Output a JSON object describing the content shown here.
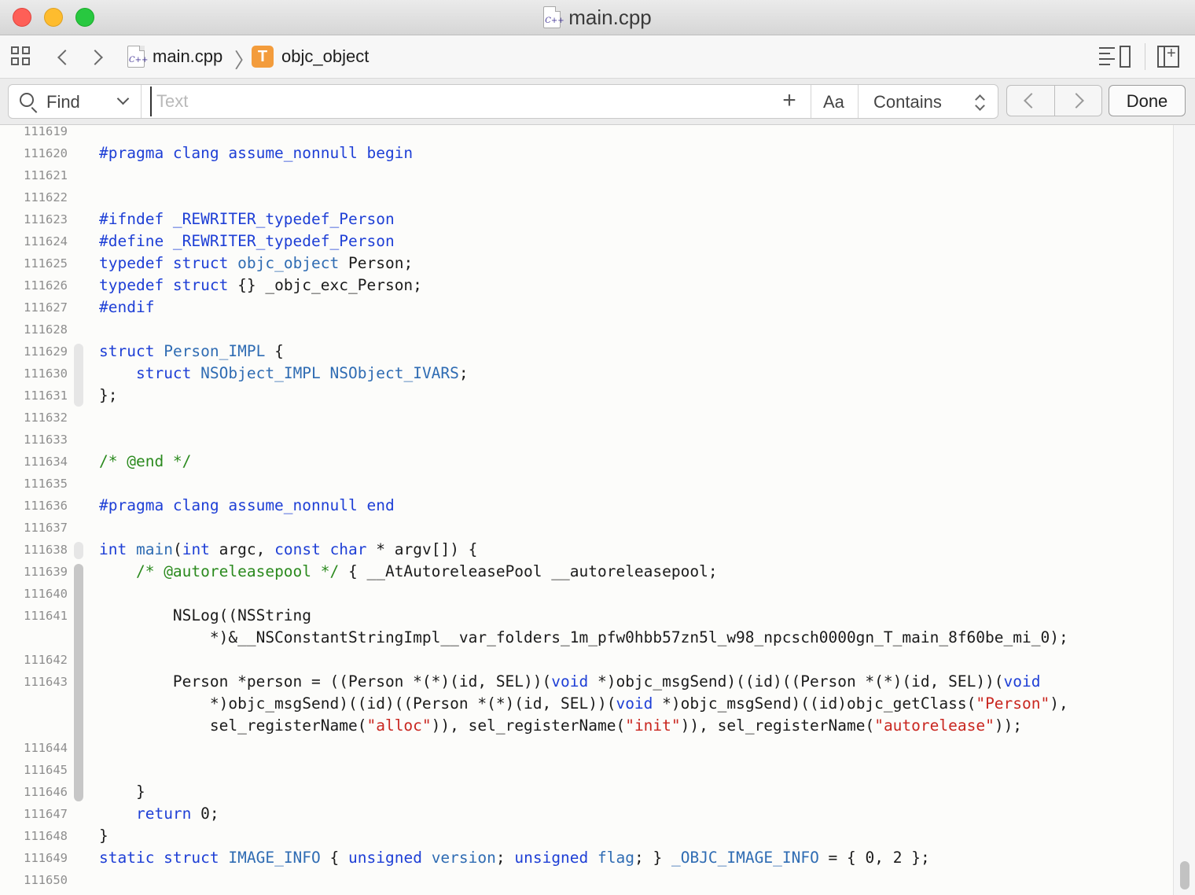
{
  "window": {
    "title": "main.cpp",
    "file_icon_label": "C++"
  },
  "nav": {
    "crumb_file": "main.cpp",
    "crumb_symbol_badge": "T",
    "crumb_symbol": "objc_object"
  },
  "find": {
    "mode": "Find",
    "placeholder": "Text",
    "value": "",
    "case_label": "Aa",
    "match_mode": "Contains",
    "done_label": "Done"
  },
  "editor": {
    "lines": [
      {
        "n": "111619",
        "code": ""
      },
      {
        "n": "111620",
        "code": "<span class=\"kw\">#pragma clang assume_nonnull begin</span>"
      },
      {
        "n": "111621",
        "code": ""
      },
      {
        "n": "111622",
        "code": ""
      },
      {
        "n": "111623",
        "code": "<span class=\"kw\">#ifndef _REWRITER_typedef_Person</span>"
      },
      {
        "n": "111624",
        "code": "<span class=\"kw\">#define _REWRITER_typedef_Person</span>"
      },
      {
        "n": "111625",
        "code": "<span class=\"kw\">typedef struct</span> <span class=\"ty\">objc_object</span> Person;"
      },
      {
        "n": "111626",
        "code": "<span class=\"kw\">typedef struct</span> {} _objc_exc_Person;"
      },
      {
        "n": "111627",
        "code": "<span class=\"kw\">#endif</span>"
      },
      {
        "n": "111628",
        "code": ""
      },
      {
        "n": "111629",
        "code": "<span class=\"kw\">struct</span> <span class=\"ty\">Person_IMPL</span> {"
      },
      {
        "n": "111630",
        "code": "    <span class=\"kw\">struct</span> <span class=\"ty\">NSObject_IMPL</span> <span class=\"ty\">NSObject_IVARS</span>;"
      },
      {
        "n": "111631",
        "code": "};"
      },
      {
        "n": "111632",
        "code": ""
      },
      {
        "n": "111633",
        "code": ""
      },
      {
        "n": "111634",
        "code": "<span class=\"cm\">/* @end */</span>"
      },
      {
        "n": "111635",
        "code": ""
      },
      {
        "n": "111636",
        "code": "<span class=\"kw\">#pragma clang assume_nonnull end</span>"
      },
      {
        "n": "111637",
        "code": ""
      },
      {
        "n": "111638",
        "code": "<span class=\"kw\">int</span> <span class=\"ty\">main</span>(<span class=\"kw\">int</span> argc, <span class=\"kw\">const char</span> * argv[]) {"
      },
      {
        "n": "111639",
        "code": "    <span class=\"cm\">/* @autoreleasepool */</span> { __AtAutoreleasePool __autoreleasepool;"
      },
      {
        "n": "111640",
        "code": ""
      },
      {
        "n": "111641",
        "code": "        NSLog((NSString"
      },
      {
        "n": "",
        "code": "            *)&amp;__NSConstantStringImpl__var_folders_1m_pfw0hbb57zn5l_w98_npcsch0000gn_T_main_8f60be_mi_0);"
      },
      {
        "n": "111642",
        "code": ""
      },
      {
        "n": "111643",
        "code": "        Person *person = ((Person *(*)(id, SEL))(<span class=\"kw\">void</span> *)objc_msgSend)((id)((Person *(*)(id, SEL))(<span class=\"kw\">void</span>"
      },
      {
        "n": "",
        "code": "            *)objc_msgSend)((id)((Person *(*)(id, SEL))(<span class=\"kw\">void</span> *)objc_msgSend)((id)objc_getClass(<span class=\"st\">\"Person\"</span>),"
      },
      {
        "n": "",
        "code": "            sel_registerName(<span class=\"st\">\"alloc\"</span>)), sel_registerName(<span class=\"st\">\"init\"</span>)), sel_registerName(<span class=\"st\">\"autorelease\"</span>));"
      },
      {
        "n": "111644",
        "code": ""
      },
      {
        "n": "111645",
        "code": ""
      },
      {
        "n": "111646",
        "code": "    }"
      },
      {
        "n": "111647",
        "code": "    <span class=\"kw\">return</span> 0;"
      },
      {
        "n": "111648",
        "code": "}"
      },
      {
        "n": "111649",
        "code": "<span class=\"kw\">static struct</span> <span class=\"ty\">IMAGE_INFO</span> { <span class=\"kw\">unsigned</span> <span class=\"ty\">version</span>; <span class=\"kw\">unsigned</span> <span class=\"ty\">flag</span>; } <span class=\"ty\">_OBJC_IMAGE_INFO</span> = { 0, 2 };"
      },
      {
        "n": "111650",
        "code": ""
      }
    ]
  }
}
